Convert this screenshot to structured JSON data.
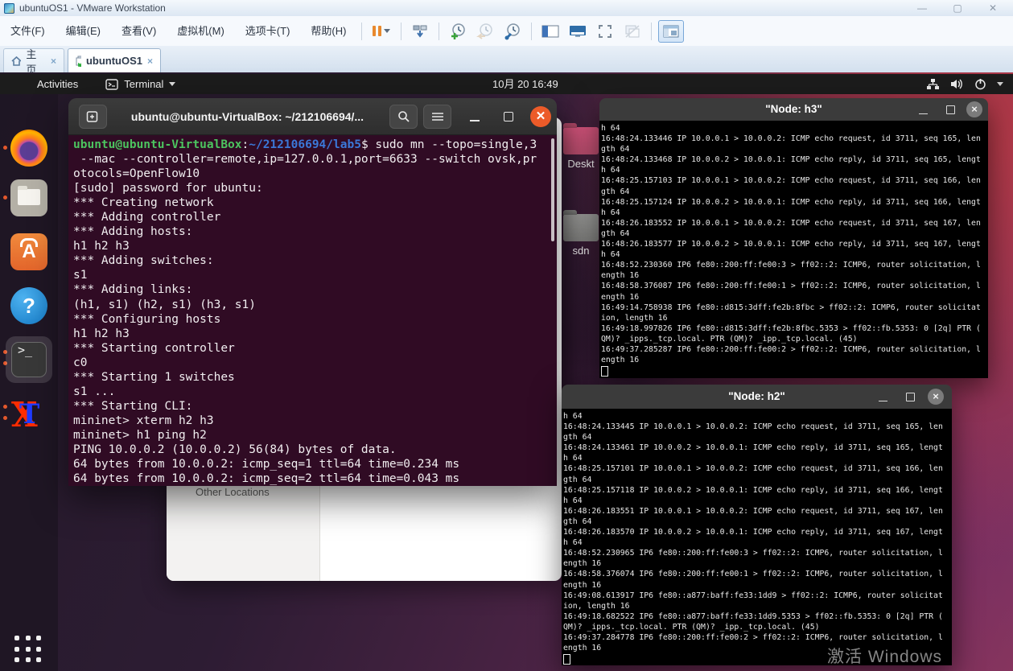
{
  "window": {
    "title": "ubuntuOS1 - VMware Workstation"
  },
  "vmware": {
    "menus": [
      "文件(F)",
      "编辑(E)",
      "查看(V)",
      "虚拟机(M)",
      "选项卡(T)",
      "帮助(H)"
    ],
    "tabs": {
      "home": "主页",
      "vm": "ubuntuOS1",
      "close": "×"
    },
    "winbtn_close": "✕"
  },
  "gnome": {
    "activities": "Activities",
    "app_menu": "Terminal",
    "clock": "10月 20 16:49"
  },
  "dock": {
    "items": [
      "firefox",
      "files",
      "ubuntu-software",
      "help",
      "terminal",
      "xterm"
    ],
    "terminal_glyph": ">_",
    "store_glyph": "A",
    "help_glyph": "?",
    "xterm_glyph_x": "X",
    "xterm_glyph_t": "T"
  },
  "desktop_icons": {
    "desktop_label": "Deskt",
    "sdn_label": "sdn"
  },
  "file_manager": {
    "other_locations": "Other Locations"
  },
  "terminal": {
    "title": "ubuntu@ubuntu-VirtualBox: ~/212106694/...",
    "prompt_user": "ubuntu@ubuntu-VirtualBox",
    "prompt_sep": ":",
    "prompt_path": "~/212106694/lab5",
    "prompt_cmd": "$ sudo mn --topo=single,3",
    "close_glyph": "✕",
    "lines": [
      " --mac --controller=remote,ip=127.0.0.1,port=6633 --switch ovsk,pr",
      "otocols=OpenFlow10",
      "[sudo] password for ubuntu:",
      "*** Creating network",
      "*** Adding controller",
      "*** Adding hosts:",
      "h1 h2 h3",
      "*** Adding switches:",
      "s1",
      "*** Adding links:",
      "(h1, s1) (h2, s1) (h3, s1)",
      "*** Configuring hosts",
      "h1 h2 h3",
      "*** Starting controller",
      "c0",
      "*** Starting 1 switches",
      "s1 ...",
      "*** Starting CLI:",
      "mininet> xterm h2 h3",
      "mininet> h1 ping h2",
      "PING 10.0.0.2 (10.0.0.2) 56(84) bytes of data.",
      "64 bytes from 10.0.0.2: icmp_seq=1 ttl=64 time=0.234 ms",
      "64 bytes from 10.0.0.2: icmp_seq=2 ttl=64 time=0.043 ms"
    ]
  },
  "node_h3": {
    "title": "\"Node: h3\"",
    "close_glyph": "×",
    "lines": [
      "h 64",
      "16:48:24.133446 IP 10.0.0.1 > 10.0.0.2: ICMP echo request, id 3711, seq 165, len",
      "gth 64",
      "16:48:24.133468 IP 10.0.0.2 > 10.0.0.1: ICMP echo reply, id 3711, seq 165, lengt",
      "h 64",
      "16:48:25.157103 IP 10.0.0.1 > 10.0.0.2: ICMP echo request, id 3711, seq 166, len",
      "gth 64",
      "16:48:25.157124 IP 10.0.0.2 > 10.0.0.1: ICMP echo reply, id 3711, seq 166, lengt",
      "h 64",
      "16:48:26.183552 IP 10.0.0.1 > 10.0.0.2: ICMP echo request, id 3711, seq 167, len",
      "gth 64",
      "16:48:26.183577 IP 10.0.0.2 > 10.0.0.1: ICMP echo reply, id 3711, seq 167, lengt",
      "h 64",
      "16:48:52.230360 IP6 fe80::200:ff:fe00:3 > ff02::2: ICMP6, router solicitation, l",
      "ength 16",
      "16:48:58.376087 IP6 fe80::200:ff:fe00:1 > ff02::2: ICMP6, router solicitation, l",
      "ength 16",
      "16:49:14.758938 IP6 fe80::d815:3dff:fe2b:8fbc > ff02::2: ICMP6, router solicitat",
      "ion, length 16",
      "16:49:18.997826 IP6 fe80::d815:3dff:fe2b:8fbc.5353 > ff02::fb.5353: 0 [2q] PTR (",
      "QM)? _ipps._tcp.local. PTR (QM)? _ipp._tcp.local. (45)",
      "16:49:37.285287 IP6 fe80::200:ff:fe00:2 > ff02::2: ICMP6, router solicitation, l",
      "ength 16"
    ]
  },
  "node_h2": {
    "title": "\"Node: h2\"",
    "close_glyph": "×",
    "lines": [
      "h 64",
      "16:48:24.133445 IP 10.0.0.1 > 10.0.0.2: ICMP echo request, id 3711, seq 165, len",
      "gth 64",
      "16:48:24.133461 IP 10.0.0.2 > 10.0.0.1: ICMP echo reply, id 3711, seq 165, lengt",
      "h 64",
      "16:48:25.157101 IP 10.0.0.1 > 10.0.0.2: ICMP echo request, id 3711, seq 166, len",
      "gth 64",
      "16:48:25.157118 IP 10.0.0.2 > 10.0.0.1: ICMP echo reply, id 3711, seq 166, lengt",
      "h 64",
      "16:48:26.183551 IP 10.0.0.1 > 10.0.0.2: ICMP echo request, id 3711, seq 167, len",
      "gth 64",
      "16:48:26.183570 IP 10.0.0.2 > 10.0.0.1: ICMP echo reply, id 3711, seq 167, lengt",
      "h 64",
      "16:48:52.230965 IP6 fe80::200:ff:fe00:3 > ff02::2: ICMP6, router solicitation, l",
      "ength 16",
      "16:48:58.376074 IP6 fe80::200:ff:fe00:1 > ff02::2: ICMP6, router solicitation, l",
      "ength 16",
      "16:49:08.613917 IP6 fe80::a877:baff:fe33:1dd9 > ff02::2: ICMP6, router solicitat",
      "ion, length 16",
      "16:49:18.682522 IP6 fe80::a877:baff:fe33:1dd9.5353 > ff02::fb.5353: 0 [2q] PTR (",
      "QM)? _ipps._tcp.local. PTR (QM)? _ipp._tcp.local. (45)",
      "16:49:37.284778 IP6 fe80::200:ff:fe00:2 > ff02::2: ICMP6, router solicitation, l",
      "ength 16"
    ]
  },
  "watermark": "激活 Windows",
  "colors": {
    "ubuntu_orange": "#e95420",
    "terminal_bg": "#300b24",
    "prompt_green": "#4cc45f",
    "prompt_blue": "#3b78d8",
    "topbar_bg": "#1c1c1c"
  }
}
